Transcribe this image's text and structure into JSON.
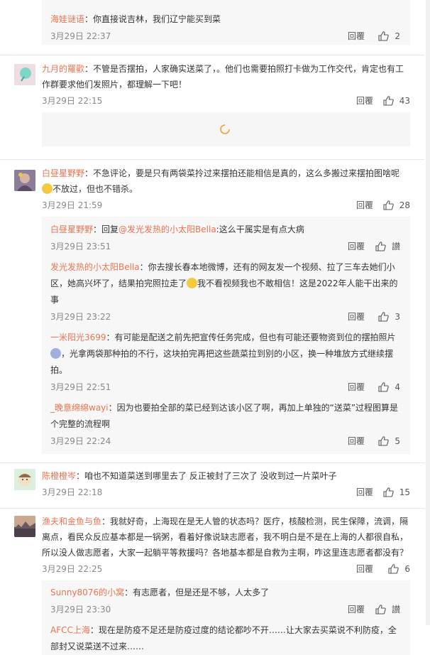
{
  "labels": {
    "reply": "回覆",
    "like_icon": "thumbs-up-icon"
  },
  "top_reply": {
    "user": "海娃谜语",
    "text": "：你直接说吉林，我们辽宁能买到菜",
    "date": "3月29日 22:37",
    "likes": "2"
  },
  "c1": {
    "user": "九月的羅歡",
    "text": "：不管是否摆拍，人家确实送菜了，。他们也需要拍照打卡做为工作交代，肯定也有工作群要求他们发照片，都理解一下吧！",
    "date": "3月29日 22:15",
    "likes": "43"
  },
  "c2": {
    "user": "白昼星野野",
    "text_a": "：不急评论，要是只有两袋菜拎过来摆拍还能相信是真的，这么多搬过来摆拍图啥呢",
    "text_b": "不放过，但也不错杀。",
    "date": "3月29日 21:59",
    "likes": "28"
  },
  "r1": {
    "user": "白昼星野野",
    "prefix": "：回复",
    "mention": "@发光发热的小太阳Bella",
    "text": ":这么干属实是有点大病",
    "date": "3月29日 23:51",
    "likes": "讃"
  },
  "r2": {
    "user": "发光发热的小太阳Bella",
    "text_a": "：你去搜长春本地微博，还有的网友发一个视频、拉了三车去她们小区，她高兴坏了，结果拍完照拉走了",
    "text_b": "我不看视频我也不敢相信！这是2022年人能干出来的事",
    "date": "3月29日 23:22",
    "likes": "3"
  },
  "r3": {
    "user": "一米阳光3699",
    "text_a": "：有可能是配送之前先把宣传任务完成，但也有可能还要物资到位的摆拍照片",
    "text_b": "，光拿两袋那种拍的不行，这块拍完再把这些蔬菜拉到别的小区，换一种堆放方式继续摆拍。",
    "date": "3月29日 22:51",
    "likes": "4"
  },
  "r4": {
    "user": "_晚意绵绵wayi",
    "text": "：因为也要拍全部的菜已经到达该小区了啊，再加上单独的“送菜”过程图算是个完整的流程啊",
    "date": "3月29日 22:24",
    "likes": "5"
  },
  "c3": {
    "user": "陈橙橙岑",
    "text": "：咱也不知道菜送到哪里去了 反正被封了三次了 没收到过一片菜叶子",
    "date": "3月29日 22:18",
    "likes": "15"
  },
  "c4": {
    "user": "渔夫和金鱼与鱼",
    "text": "：我就好奇，上海现在是无人管的状态吗？医疗，核酸检测，民生保障，流调，隔离点，看民众反应基本都是一锅粥，看着好像说缺志愿者，我不明白是不是在上海的人都很自私，所以没人做志愿者，大家一起躺平等救援吗？各地基本都是自救为主啊，咋这里连志愿者都没有？",
    "date": "3月29日 22:25",
    "likes": "6"
  },
  "r5": {
    "user": "Sunny8076的小窝",
    "text": "：有志愿者，但是还是不够，人太多了",
    "date": "3月29日 23:30",
    "likes": "讃"
  },
  "r6": {
    "user": "AFCC上海",
    "text": "：现在是防疫不足还是防疫过度的结论都吵不开……让大家去买菜说不利防疫，全部封又说菜送不过来……"
  }
}
